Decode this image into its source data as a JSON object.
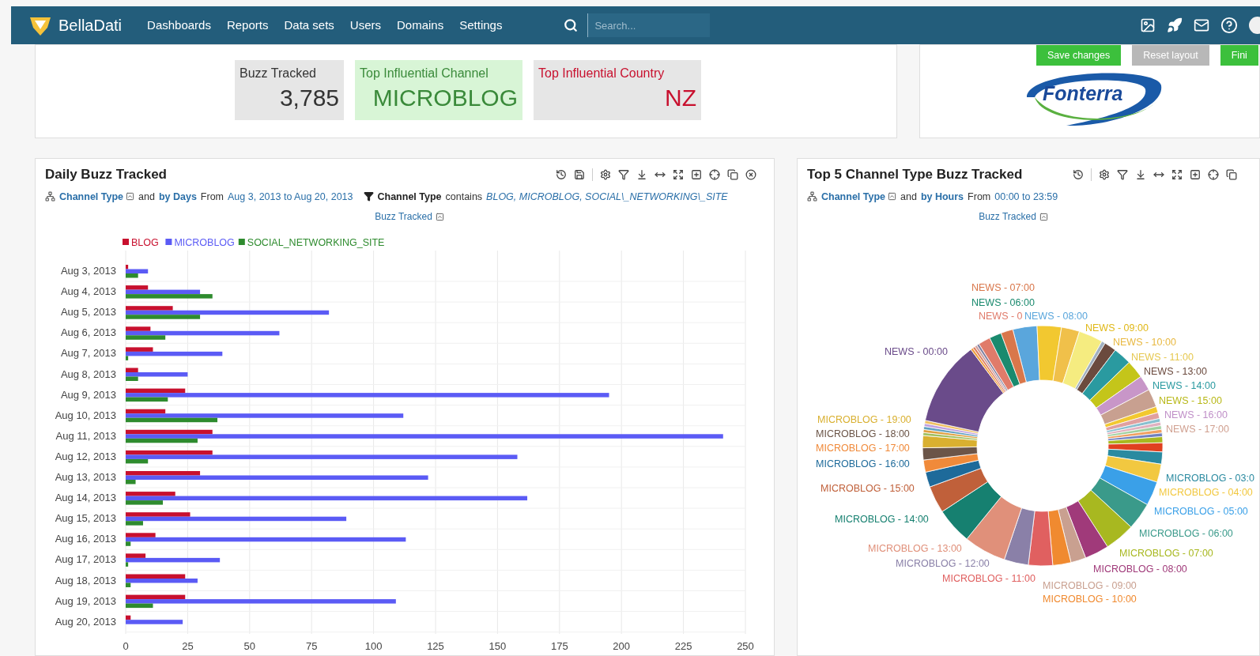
{
  "navbar": {
    "brand": "BellaDati",
    "menu": [
      "Dashboards",
      "Reports",
      "Data sets",
      "Users",
      "Domains",
      "Settings"
    ],
    "search": {
      "placeholder": "Search..."
    }
  },
  "kpis": [
    {
      "label": "Buzz Tracked",
      "value": "3,785",
      "kind": "neutral"
    },
    {
      "label": "Top Influential Channel",
      "value": "MICROBLOG",
      "kind": "positive"
    },
    {
      "label": "Top Influential Country",
      "value": "NZ",
      "kind": "negative"
    }
  ],
  "layout_buttons": [
    {
      "label": "Save changes",
      "kind": "primary"
    },
    {
      "label": "Reset layout",
      "kind": "secondary"
    },
    {
      "label": "Fini",
      "kind": "primary"
    }
  ],
  "logo": {
    "text": "Fonterra"
  },
  "daily_panel": {
    "title": "Daily Buzz Tracked",
    "measure": "Buzz Tracked",
    "subtitle": [
      {
        "kind": "drill",
        "text": "Channel Type",
        "toggle": true
      },
      {
        "kind": "plain",
        "text": "and"
      },
      {
        "kind": "drill",
        "text": "by Days",
        "toggle": false
      },
      {
        "kind": "plain",
        "text": "From"
      },
      {
        "kind": "range",
        "text": "Aug 3, 2013 to Aug 20, 2013"
      },
      {
        "kind": "filter",
        "text": "Channel Type"
      },
      {
        "kind": "plain",
        "text": "contains"
      },
      {
        "kind": "values",
        "text": "BLOG, MICROBLOG, SOCIAL\\_NETWORKING\\_SITE"
      }
    ],
    "chart_data": {
      "type": "bar",
      "orientation": "horizontal",
      "categories": [
        "Aug 3, 2013",
        "Aug 4, 2013",
        "Aug 5, 2013",
        "Aug 6, 2013",
        "Aug 7, 2013",
        "Aug 8, 2013",
        "Aug 9, 2013",
        "Aug 10, 2013",
        "Aug 11, 2013",
        "Aug 12, 2013",
        "Aug 13, 2013",
        "Aug 14, 2013",
        "Aug 15, 2013",
        "Aug 16, 2013",
        "Aug 17, 2013",
        "Aug 18, 2013",
        "Aug 19, 2013",
        "Aug 20, 2013"
      ],
      "series": [
        {
          "name": "BLOG",
          "color": "#c8102e",
          "values": [
            1,
            9,
            19,
            10,
            11,
            5,
            24,
            16,
            35,
            35,
            30,
            20,
            26,
            12,
            8,
            24,
            24,
            2
          ]
        },
        {
          "name": "MICROBLOG",
          "color": "#5b5bf5",
          "values": [
            9,
            30,
            82,
            62,
            39,
            25,
            195,
            112,
            241,
            158,
            122,
            162,
            89,
            113,
            38,
            29,
            109,
            23
          ]
        },
        {
          "name": "SOCIAL_NETWORKING_SITE",
          "color": "#2e8b2e",
          "values": [
            5,
            35,
            30,
            16,
            1,
            5,
            17,
            37,
            29,
            9,
            4,
            15,
            7,
            2,
            1,
            2,
            11,
            null
          ]
        }
      ],
      "grid": true,
      "legend": "top",
      "xlim": [
        0,
        250
      ],
      "xticks": [
        0,
        25,
        50,
        75,
        100,
        125,
        150,
        175,
        200,
        225,
        250
      ]
    }
  },
  "channel_panel": {
    "title": "Top 5 Channel Type Buzz Tracked",
    "measure": "Buzz Tracked",
    "subtitle": [
      {
        "kind": "drill",
        "text": "Channel Type",
        "toggle": true
      },
      {
        "kind": "plain",
        "text": "and"
      },
      {
        "kind": "drill",
        "text": "by Hours",
        "toggle": false
      },
      {
        "kind": "plain",
        "text": "From"
      },
      {
        "kind": "range",
        "text": "00:00 to 23:59"
      }
    ],
    "donut_labels": [
      {
        "text": "NEWS - 07:00",
        "color": "#d9774b"
      },
      {
        "text": "NEWS - 06:00",
        "color": "#1a8a6e"
      },
      {
        "text": "NEWS - 0",
        "color": "#e07b6a"
      },
      {
        "text": "NEWS - 08:00",
        "color": "#5aa6dc"
      },
      {
        "text": "NEWS - 09:00",
        "color": "#e0b818"
      },
      {
        "text": "NEWS - 10:00",
        "color": "#e8b840"
      },
      {
        "text": "NEWS - 00:00",
        "color": "#6a4b8a"
      },
      {
        "text": "NEWS - 11:00",
        "color": "#e6c850"
      },
      {
        "text": "NEWS - 13:00",
        "color": "#6b4a3e"
      },
      {
        "text": "NEWS - 14:00",
        "color": "#2a9aa0"
      },
      {
        "text": "NEWS - 15:00",
        "color": "#b8b818"
      },
      {
        "text": "NEWS - 16:00",
        "color": "#c090c8"
      },
      {
        "text": "MICROBLOG - 19:00",
        "color": "#d9b030"
      },
      {
        "text": "NEWS - 17:00",
        "color": "#d0a090"
      },
      {
        "text": "MICROBLOG - 18:00",
        "color": "#6b5548"
      },
      {
        "text": "MICROBLOG - 17:00",
        "color": "#f08a3a"
      },
      {
        "text": "MICROBLOG - 16:00",
        "color": "#1e6a9a"
      },
      {
        "text": "MICROBLOG - 03:0",
        "color": "#2a8aa0"
      },
      {
        "text": "MICROBLOG - 15:00",
        "color": "#c0603a"
      },
      {
        "text": "MICROBLOG - 04:00",
        "color": "#f2c840"
      },
      {
        "text": "MICROBLOG - 05:00",
        "color": "#3aa0e8"
      },
      {
        "text": "MICROBLOG - 14:00",
        "color": "#168070"
      },
      {
        "text": "MICROBLOG - 06:00",
        "color": "#3a9a8a"
      },
      {
        "text": "MICROBLOG - 13:00",
        "color": "#e0907a"
      },
      {
        "text": "MICROBLOG - 07:00",
        "color": "#a8b820"
      },
      {
        "text": "MICROBLOG - 12:00",
        "color": "#8a80a8"
      },
      {
        "text": "MICROBLOG - 08:00",
        "color": "#a03a7a"
      },
      {
        "text": "MICROBLOG - 11:00",
        "color": "#e06060"
      },
      {
        "text": "MICROBLOG - 09:00",
        "color": "#c9a090"
      },
      {
        "text": "MICROBLOG - 10:00",
        "color": "#f08a30"
      }
    ]
  }
}
